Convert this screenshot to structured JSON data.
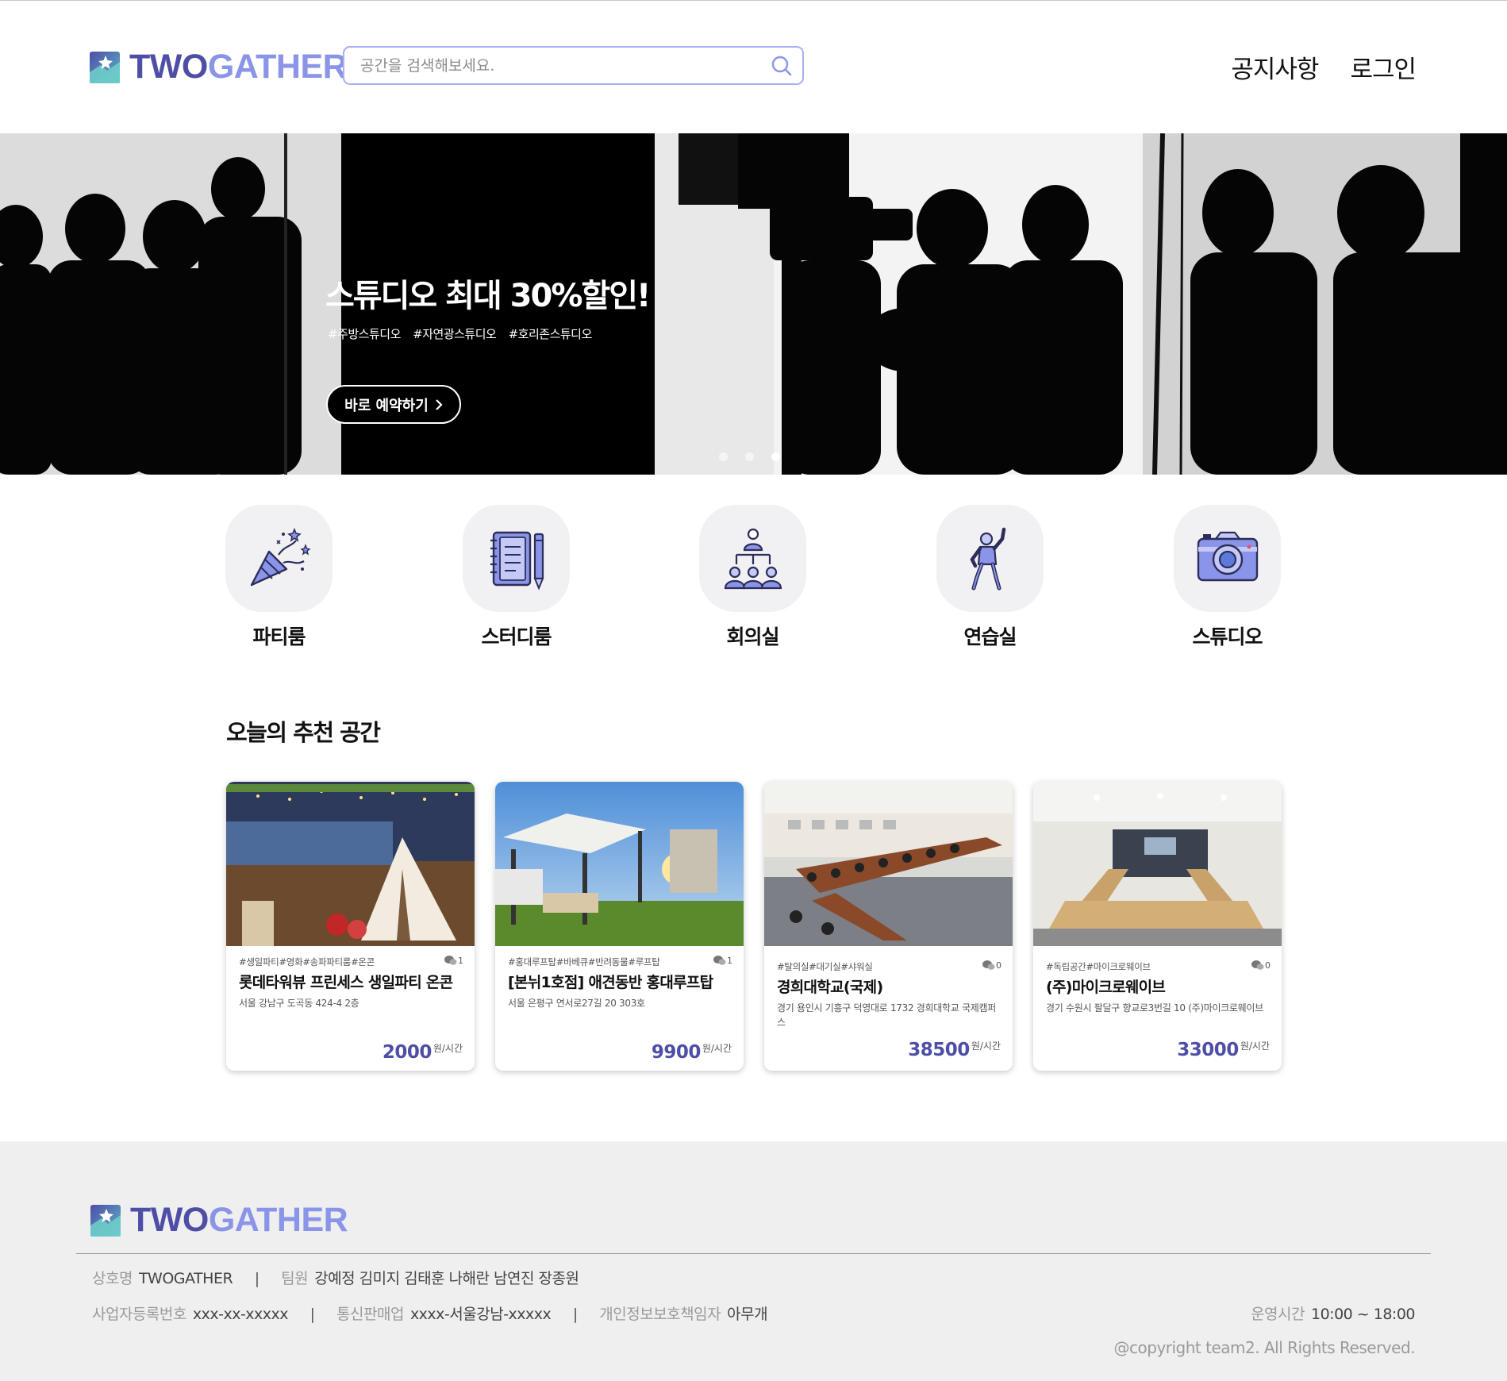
{
  "brand": {
    "two": "TWO",
    "gather": "GATHER"
  },
  "search": {
    "placeholder": "공간을 검색해보세요."
  },
  "nav": {
    "notice": "공지사항",
    "login": "로그인"
  },
  "hero": {
    "title": "스튜디오 최대 30%할인!",
    "tags": [
      "#주방스튜디오",
      "#자연광스튜디오",
      "#호리존스튜디오"
    ],
    "cta": "바로 예약하기",
    "slide_count": 3,
    "active_slide": 3
  },
  "categories": [
    {
      "label": "파티룸",
      "icon": "party-popper-icon"
    },
    {
      "label": "스터디룸",
      "icon": "notebook-pencil-icon"
    },
    {
      "label": "회의실",
      "icon": "meeting-icon"
    },
    {
      "label": "연습실",
      "icon": "dancer-icon"
    },
    {
      "label": "스튜디오",
      "icon": "camera-icon"
    }
  ],
  "recommend": {
    "title": "오늘의 추천 공간",
    "cards": [
      {
        "tags": "#생일파티#영화#송파파티룸#온콘",
        "comments": "1",
        "title": "롯데타워뷰 프린세스 생일파티 온콘",
        "address": "서울 강남구 도곡동 424-4 2층",
        "price": "2000",
        "unit": "원/시간"
      },
      {
        "tags": "#홍대루프탑#바베큐#반려동물#루프탑",
        "comments": "1",
        "title": "[본뉘1호점] 애견동반 홍대루프탑",
        "address": "서울 은평구 연서로27길 20 303호",
        "price": "9900",
        "unit": "원/시간"
      },
      {
        "tags": "#탈의실#대기실#샤워실",
        "comments": "0",
        "title": "경희대학교(국제)",
        "address": "경기 용인시 기흥구 덕영대로 1732 경희대학교 국제캠퍼스",
        "price": "38500",
        "unit": "원/시간"
      },
      {
        "tags": "#독립공간#마이크로웨이브",
        "comments": "0",
        "title": "(주)마이크로웨이브",
        "address": "경기 수원시 팔달구 향교로3번길 10 (주)마이크로웨이브",
        "price": "33000",
        "unit": "원/시간"
      }
    ]
  },
  "footer": {
    "company_label": "상호명",
    "company": "TWOGATHER",
    "team_label": "팀원",
    "team": "강예정 김미지 김태훈 나해란 남연진 장종원",
    "biz_label": "사업자등록번호",
    "biz": "xxx-xx-xxxxx",
    "mail_label": "통신판매업",
    "mail": "xxxx-서울강남-xxxxx",
    "privacy_label": "개인정보보호책임자",
    "privacy": "아무개",
    "hours_label": "운영시간",
    "hours": "10:00 ~ 18:00",
    "copyright": "@copyright team2. All Rights Reserved."
  },
  "colors": {
    "brand_dark": "#4f4ea6",
    "brand_light": "#8a94e8",
    "search_border": "#a8b0ee",
    "footer_bg": "#efefef"
  }
}
